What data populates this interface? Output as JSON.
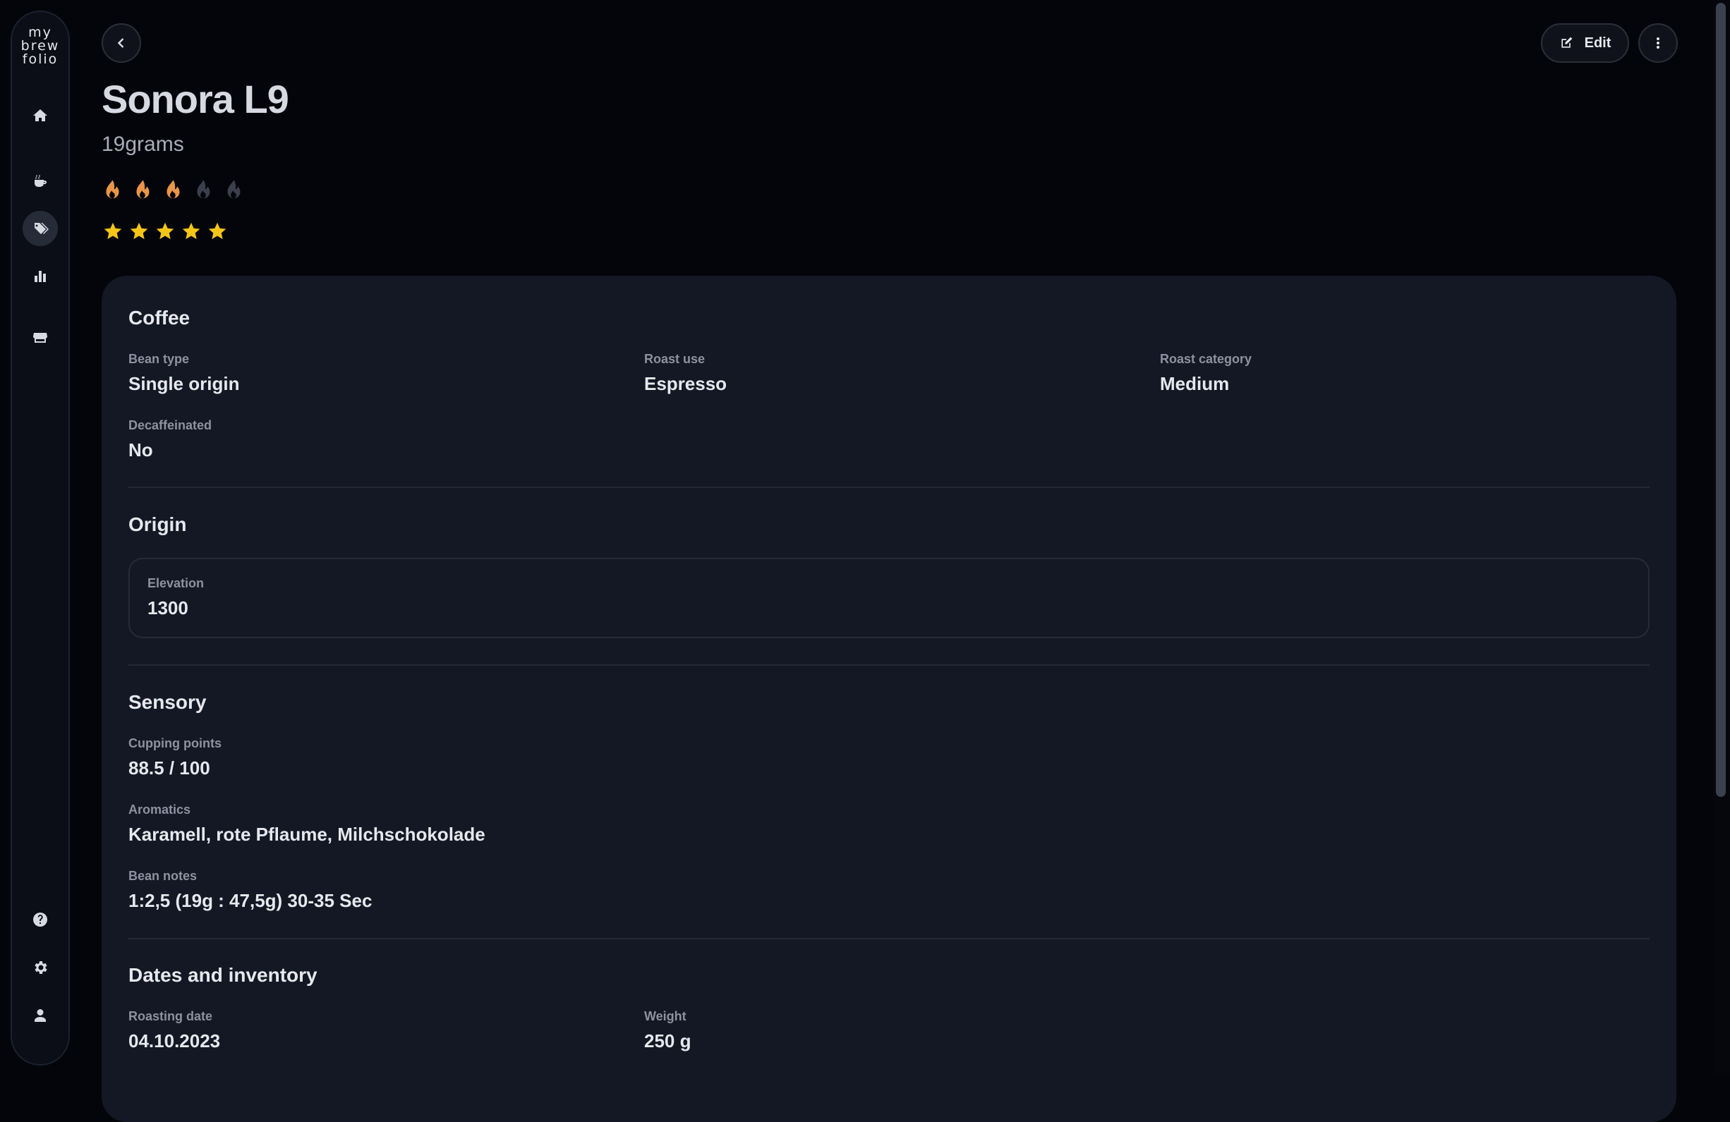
{
  "app": {
    "logo_lines": [
      "my",
      "brew",
      "folio"
    ]
  },
  "sidebar": {
    "items": [
      {
        "name": "home",
        "icon": "home-icon"
      },
      {
        "name": "brews",
        "icon": "coffee-cup-icon"
      },
      {
        "name": "beans",
        "icon": "tags-icon",
        "active": true
      },
      {
        "name": "statistics",
        "icon": "bar-chart-icon"
      },
      {
        "name": "roasters",
        "icon": "store-icon"
      }
    ],
    "bottom_items": [
      {
        "name": "help",
        "icon": "help-icon"
      },
      {
        "name": "settings",
        "icon": "gear-icon"
      },
      {
        "name": "profile",
        "icon": "user-icon"
      }
    ]
  },
  "toolbar": {
    "edit_label": "Edit"
  },
  "bean": {
    "name": "Sonora L9",
    "roaster": "19grams",
    "roast_level": 3,
    "roast_max": 5,
    "rating": 5,
    "rating_max": 5
  },
  "sections": {
    "coffee": {
      "title": "Coffee",
      "bean_type_label": "Bean type",
      "bean_type": "Single origin",
      "roast_use_label": "Roast use",
      "roast_use": "Espresso",
      "roast_category_label": "Roast category",
      "roast_category": "Medium",
      "decaf_label": "Decaffeinated",
      "decaf": "No"
    },
    "origin": {
      "title": "Origin",
      "elevation_label": "Elevation",
      "elevation": "1300"
    },
    "sensory": {
      "title": "Sensory",
      "cupping_label": "Cupping points",
      "cupping": "88.5 / 100",
      "aromatics_label": "Aromatics",
      "aromatics": "Karamell, rote Pflaume, Milchschokolade",
      "notes_label": "Bean notes",
      "notes": "1:2,5 (19g : 47,5g) 30-35 Sec"
    },
    "dates": {
      "title": "Dates and inventory",
      "roasting_date_label": "Roasting date",
      "roasting_date": "04.10.2023",
      "weight_label": "Weight",
      "weight": "250 g"
    }
  },
  "colors": {
    "accent_roast": "#e8954a",
    "roast_inactive": "#3a3f4b",
    "star": "#f5c518"
  }
}
